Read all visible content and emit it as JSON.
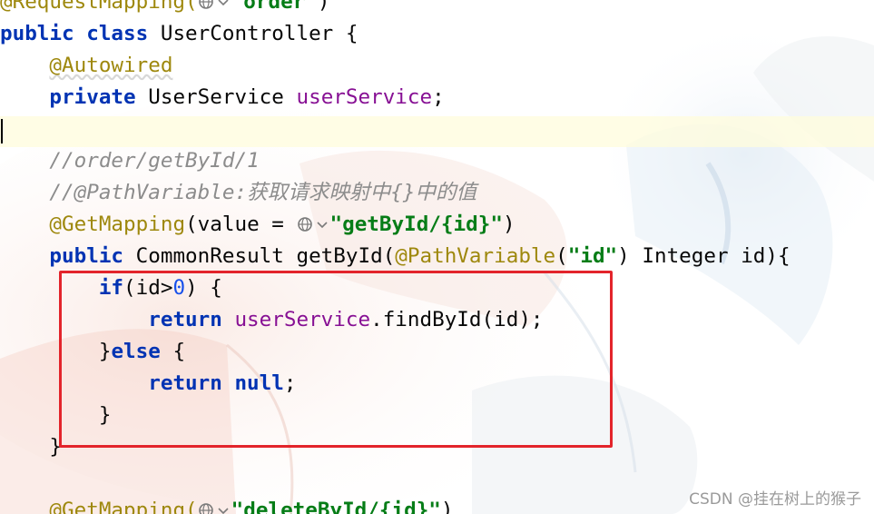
{
  "editor": {
    "lines": [
      [
        {
          "text": "@RequestMapping(",
          "cls": "annot"
        },
        {
          "icon": "globe-link"
        },
        {
          "text": "\"order\"",
          "cls": "str"
        },
        {
          "text": ")",
          "cls": "plain"
        }
      ],
      [
        {
          "text": "public class ",
          "cls": "kw"
        },
        {
          "text": "UserController {",
          "cls": "plain"
        }
      ],
      [
        {
          "text": "    ",
          "cls": "plain"
        },
        {
          "text": "@Autowired",
          "cls": "annot squiggle"
        }
      ],
      [
        {
          "text": "    ",
          "cls": "plain"
        },
        {
          "text": "private ",
          "cls": "kw"
        },
        {
          "text": "UserService ",
          "cls": "plain"
        },
        {
          "text": "userService",
          "cls": "field"
        },
        {
          "text": ";",
          "cls": "plain"
        }
      ],
      [
        {
          "text": "",
          "cls": "plain"
        }
      ],
      [
        {
          "text": "    ",
          "cls": "plain"
        },
        {
          "text": "//order/getById/1",
          "cls": "comment"
        }
      ],
      [
        {
          "text": "    ",
          "cls": "plain"
        },
        {
          "text": "//@PathVariable:获取请求映射中{}中的值",
          "cls": "comment"
        }
      ],
      [
        {
          "text": "    ",
          "cls": "plain"
        },
        {
          "text": "@GetMapping",
          "cls": "annot"
        },
        {
          "text": "(value = ",
          "cls": "plain"
        },
        {
          "icon": "globe-link"
        },
        {
          "text": "\"getById/{id}\"",
          "cls": "str"
        },
        {
          "text": ")",
          "cls": "plain"
        }
      ],
      [
        {
          "text": "    ",
          "cls": "plain"
        },
        {
          "text": "public ",
          "cls": "kw"
        },
        {
          "text": "CommonResult getById(",
          "cls": "plain"
        },
        {
          "text": "@PathVariable",
          "cls": "annot"
        },
        {
          "text": "(",
          "cls": "plain"
        },
        {
          "text": "\"id\"",
          "cls": "str"
        },
        {
          "text": ") Integer id){",
          "cls": "plain"
        }
      ],
      [
        {
          "text": "        ",
          "cls": "plain"
        },
        {
          "text": "if",
          "cls": "kw"
        },
        {
          "text": "(id>",
          "cls": "plain"
        },
        {
          "text": "0",
          "cls": "num"
        },
        {
          "text": ") {",
          "cls": "plain"
        }
      ],
      [
        {
          "text": "            ",
          "cls": "plain"
        },
        {
          "text": "return ",
          "cls": "kw"
        },
        {
          "text": "userService",
          "cls": "field"
        },
        {
          "text": ".findById(id);",
          "cls": "plain"
        }
      ],
      [
        {
          "text": "        }",
          "cls": "plain"
        },
        {
          "text": "else ",
          "cls": "kw"
        },
        {
          "text": "{",
          "cls": "plain"
        }
      ],
      [
        {
          "text": "            ",
          "cls": "plain"
        },
        {
          "text": "return ",
          "cls": "kw"
        },
        {
          "text": "null",
          "cls": "kw"
        },
        {
          "text": ";",
          "cls": "plain"
        }
      ],
      [
        {
          "text": "        }",
          "cls": "plain"
        }
      ],
      [
        {
          "text": "    }",
          "cls": "plain"
        }
      ],
      [
        {
          "text": "",
          "cls": "plain"
        }
      ],
      [
        {
          "text": "    ",
          "cls": "plain"
        },
        {
          "text": "@GetMapping(",
          "cls": "annot"
        },
        {
          "icon": "globe-link"
        },
        {
          "text": "\"deleteById/{id}\"",
          "cls": "str"
        },
        {
          "text": ")",
          "cls": "plain"
        }
      ]
    ]
  },
  "watermark": "CSDN @挂在树上的猴子",
  "colors": {
    "keyword": "#0033b3",
    "annotation": "#9e880d",
    "string": "#067d17",
    "field": "#871094",
    "number": "#1750eb",
    "comment": "#8c8c8c",
    "highlight_box": "#e3242b"
  }
}
